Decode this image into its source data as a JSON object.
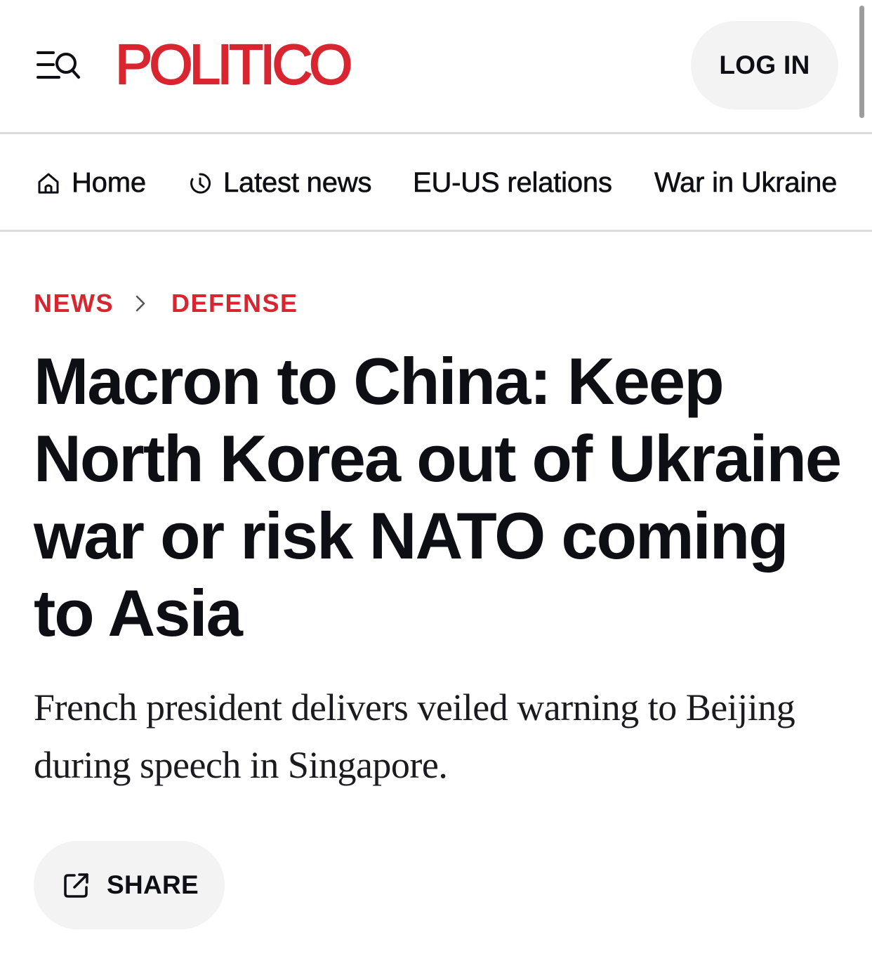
{
  "header": {
    "logo": "POLITICO",
    "login_label": "LOG IN",
    "menu_icon": "menu-search-icon",
    "brand_color": "#d8252f"
  },
  "nav": {
    "items": [
      {
        "label": "Home",
        "icon": "home-icon"
      },
      {
        "label": "Latest news",
        "icon": "clock-icon"
      },
      {
        "label": "EU-US relations"
      },
      {
        "label": "War in Ukraine"
      }
    ]
  },
  "breadcrumb": {
    "items": [
      "NEWS",
      "DEFENSE"
    ],
    "separator_icon": "chevron-right-icon"
  },
  "article": {
    "headline": "Macron to China: Keep North Korea out of Ukraine war or risk NATO coming to Asia",
    "subtitle": "French president delivers veiled warning to Beijing during speech in Singapore."
  },
  "share": {
    "label": "SHARE",
    "icon": "share-icon"
  }
}
